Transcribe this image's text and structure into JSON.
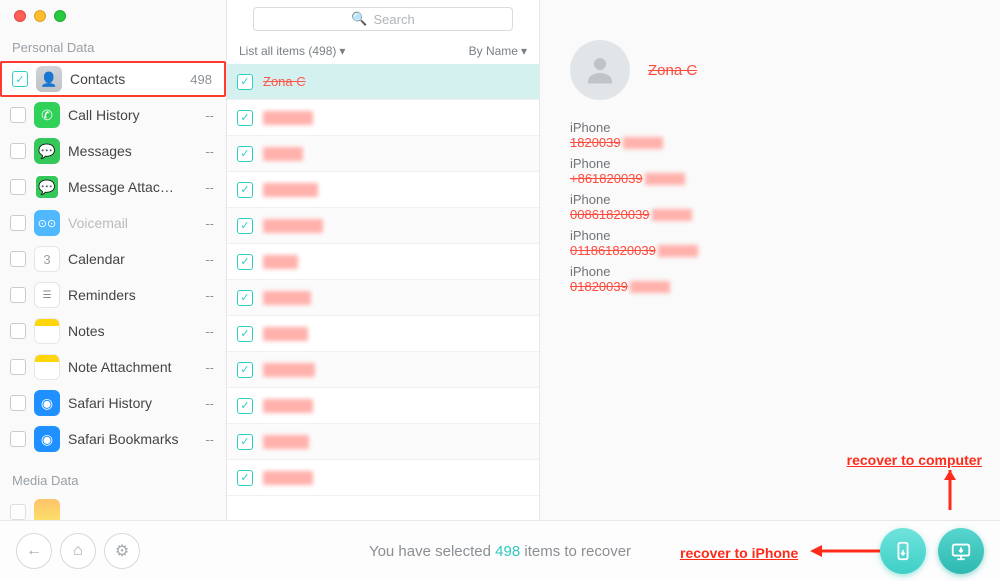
{
  "search": {
    "placeholder": "Search"
  },
  "sidebar": {
    "section_personal": "Personal Data",
    "section_media": "Media Data",
    "items": [
      {
        "label": "Contacts",
        "count": "498",
        "checked": true
      },
      {
        "label": "Call History",
        "count": "--"
      },
      {
        "label": "Messages",
        "count": "--"
      },
      {
        "label": "Message Attac…",
        "count": "--"
      },
      {
        "label": "Voicemail",
        "count": "--"
      },
      {
        "label": "Calendar",
        "count": "--"
      },
      {
        "label": "Reminders",
        "count": "--"
      },
      {
        "label": "Notes",
        "count": "--"
      },
      {
        "label": "Note Attachment",
        "count": "--"
      },
      {
        "label": "Safari History",
        "count": "--"
      },
      {
        "label": "Safari Bookmarks",
        "count": "--"
      }
    ]
  },
  "filter": {
    "list_label": "List all items (498)",
    "sort_label": "By Name"
  },
  "contacts": {
    "selected_name": "Zona C"
  },
  "detail": {
    "name": "Zona C",
    "fields": [
      {
        "label": "iPhone",
        "value": "1820039"
      },
      {
        "label": "iPhone",
        "value": "+861820039"
      },
      {
        "label": "iPhone",
        "value": "00861820039"
      },
      {
        "label": "iPhone",
        "value": "011861820039"
      },
      {
        "label": "iPhone",
        "value": "01820039"
      }
    ]
  },
  "footer": {
    "pre": "You have selected ",
    "count": "498",
    "post": " items to recover"
  },
  "annotations": {
    "to_phone": "recover to iPhone",
    "to_computer": "recover to computer"
  }
}
